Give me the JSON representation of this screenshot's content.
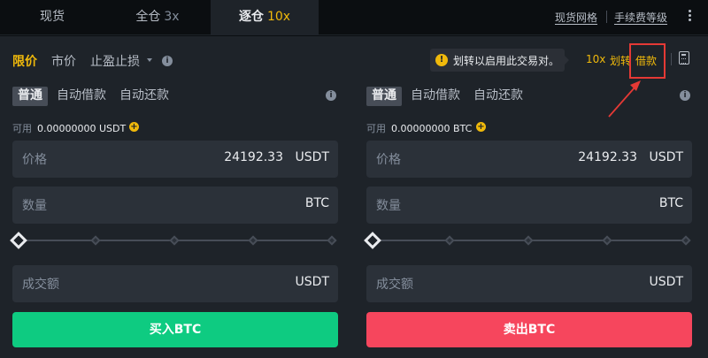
{
  "tabs": [
    {
      "label": "现货",
      "leverage": ""
    },
    {
      "label": "全仓",
      "leverage": "3x"
    },
    {
      "label": "逐仓",
      "leverage": "10x"
    }
  ],
  "top_links": {
    "grid": "现货网格",
    "fee": "手续费等级"
  },
  "order_types": {
    "limit": "限价",
    "market": "市价",
    "stop": "止盈止损"
  },
  "tooltip": {
    "text": "划转以启用此交易对。"
  },
  "header_right": {
    "leverage": "10x",
    "transfer": "划转",
    "borrow": "借款"
  },
  "buy": {
    "modes": [
      "普通",
      "自动借款",
      "自动还款"
    ],
    "available_label": "可用",
    "available_value": "0.00000000 USDT",
    "price_label": "价格",
    "price_value": "24192.33",
    "price_unit": "USDT",
    "amount_label": "数量",
    "amount_unit": "BTC",
    "total_label": "成交额",
    "total_unit": "USDT",
    "slider_percent": 0,
    "button": "买入BTC"
  },
  "sell": {
    "modes": [
      "普通",
      "自动借款",
      "自动还款"
    ],
    "available_label": "可用",
    "available_value": "0.00000000 BTC",
    "price_label": "价格",
    "price_value": "24192.33",
    "price_unit": "USDT",
    "amount_label": "数量",
    "amount_unit": "BTC",
    "total_label": "成交额",
    "total_unit": "USDT",
    "slider_percent": 0,
    "button": "卖出BTC"
  },
  "colors": {
    "accent": "#f0b90b",
    "buy": "#0ecb81",
    "sell": "#f6465d",
    "highlight": "#e53935"
  },
  "icons": [
    "info-icon",
    "warning-icon",
    "plus-icon",
    "calculator-icon",
    "more-icon",
    "annotation-arrow"
  ]
}
